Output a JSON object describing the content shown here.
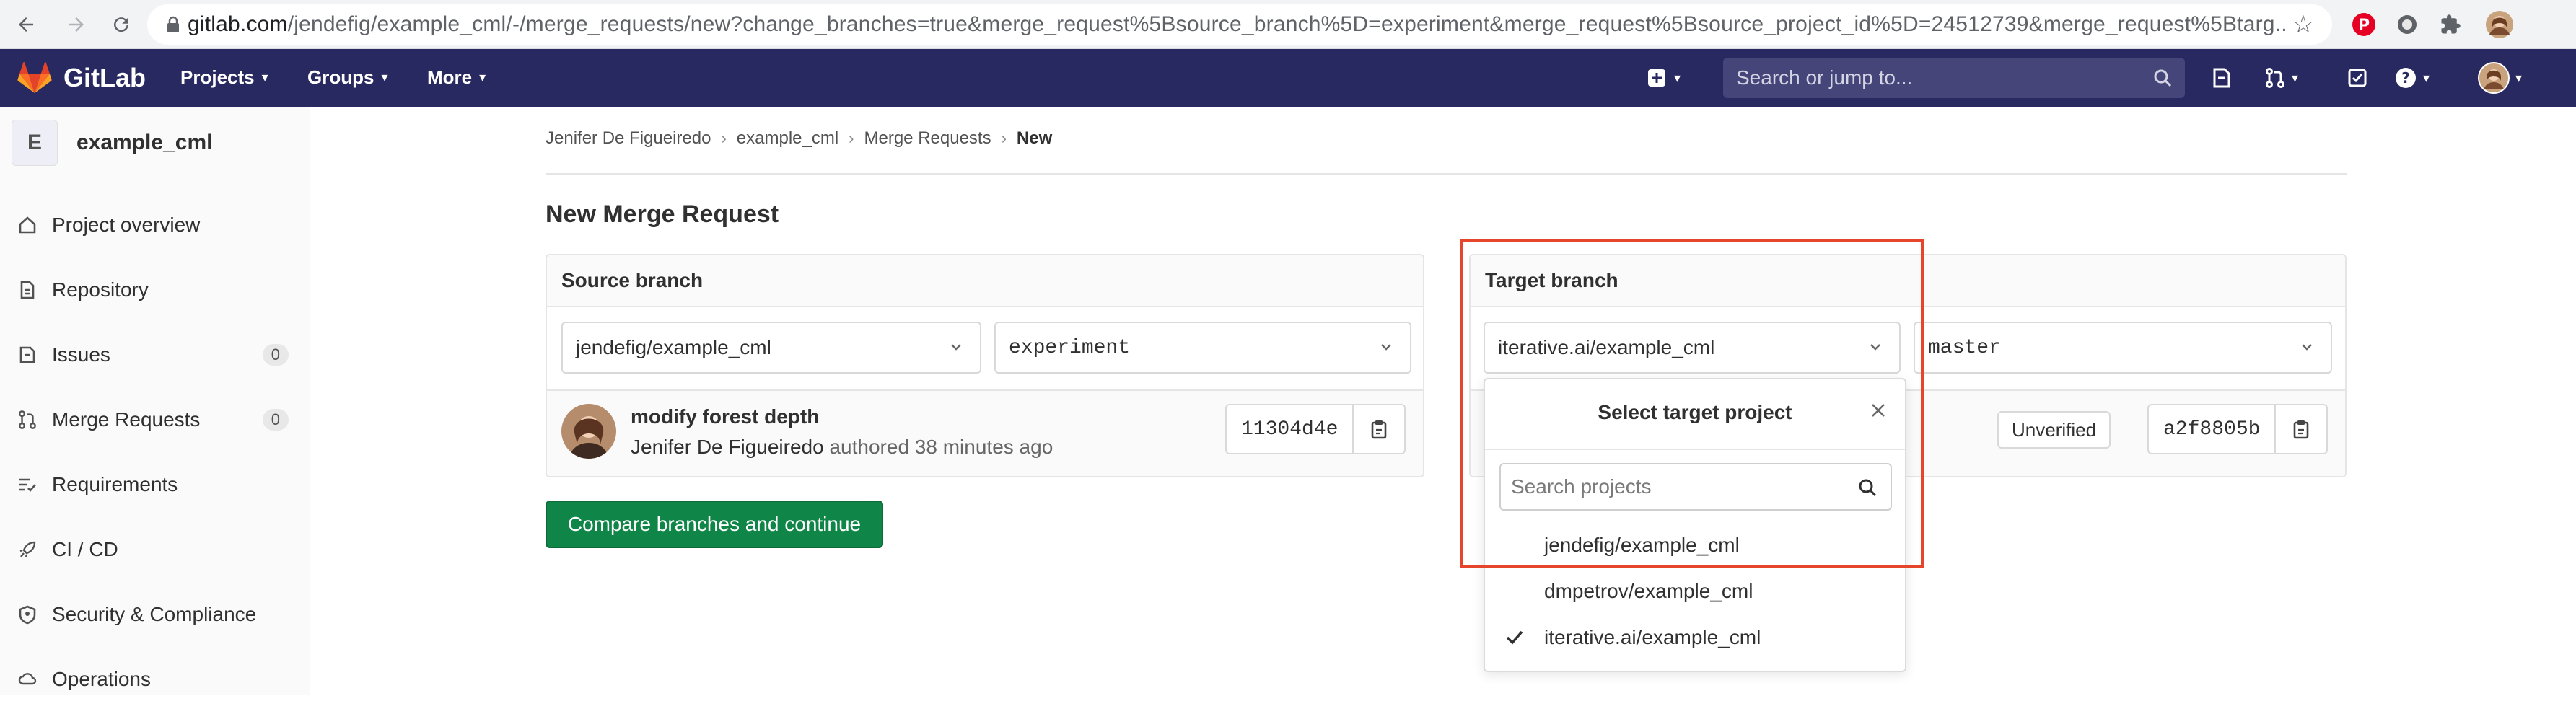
{
  "browser": {
    "url_host": "gitlab.com",
    "url_path": "/jendefig/example_cml/-/merge_requests/new?change_branches=true&merge_request%5Bsource_branch%5D=experiment&merge_request%5Bsource_project_id%5D=24512739&merge_request%5Btarg..."
  },
  "header": {
    "brand": "GitLab",
    "menus": [
      "Projects",
      "Groups",
      "More"
    ],
    "search_placeholder": "Search or jump to..."
  },
  "sidebar": {
    "project_initial": "E",
    "project_name": "example_cml",
    "items": [
      {
        "label": "Project overview"
      },
      {
        "label": "Repository"
      },
      {
        "label": "Issues",
        "count": "0"
      },
      {
        "label": "Merge Requests",
        "count": "0"
      },
      {
        "label": "Requirements"
      },
      {
        "label": "CI / CD"
      },
      {
        "label": "Security & Compliance"
      },
      {
        "label": "Operations"
      }
    ]
  },
  "breadcrumb": [
    "Jenifer De Figueiredo",
    "example_cml",
    "Merge Requests",
    "New"
  ],
  "page_title": "New Merge Request",
  "source": {
    "heading": "Source branch",
    "project": "jendefig/example_cml",
    "branch": "experiment",
    "commit_title": "modify forest depth",
    "commit_author": "Jenifer De Figueiredo",
    "commit_meta": "authored 38 minutes ago",
    "sha": "11304d4e"
  },
  "target": {
    "heading": "Target branch",
    "project": "iterative.ai/example_cml",
    "branch": "master",
    "status": "Unverified",
    "sha": "a2f8805b"
  },
  "compare_button": "Compare branches and continue",
  "dropdown": {
    "title": "Select target project",
    "search_placeholder": "Search projects",
    "options": [
      {
        "label": "jendefig/example_cml",
        "selected": false
      },
      {
        "label": "dmpetrov/example_cml",
        "selected": false
      },
      {
        "label": "iterative.ai/example_cml",
        "selected": true
      }
    ]
  },
  "colors": {
    "header_bg": "#292961",
    "button_green": "#108548",
    "highlight_red": "#e5462b"
  }
}
